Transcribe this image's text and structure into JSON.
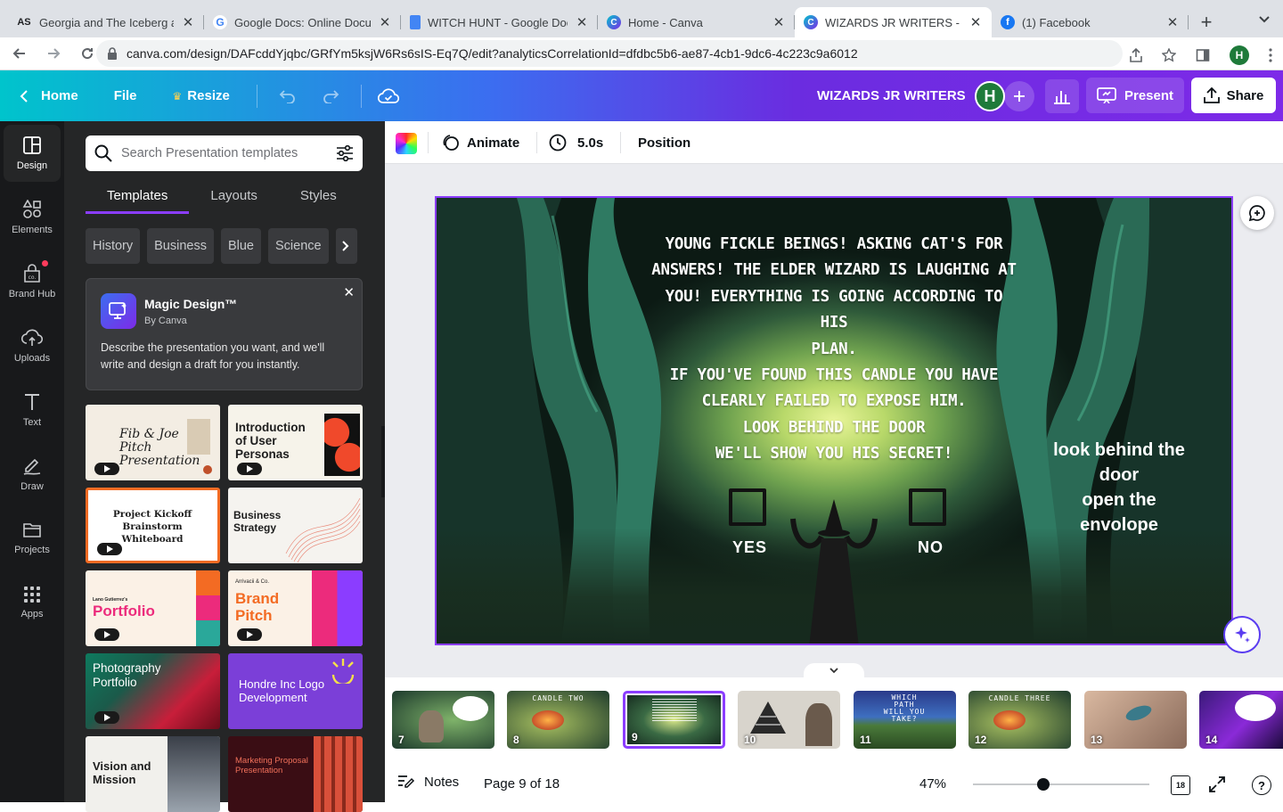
{
  "browser": {
    "tabs": [
      {
        "title": "Georgia and The Iceberg and",
        "favicon": "AS",
        "active": false
      },
      {
        "title": "Google Docs: Online Docum",
        "favicon": "G",
        "active": false
      },
      {
        "title": "WITCH HUNT - Google Doc",
        "favicon": "docs",
        "active": false
      },
      {
        "title": "Home - Canva",
        "favicon": "canva",
        "active": false
      },
      {
        "title": "WIZARDS JR WRITERS - Pr",
        "favicon": "canva",
        "active": true
      },
      {
        "title": "(1) Facebook",
        "favicon": "facebook",
        "active": false
      }
    ],
    "url": "canva.com/design/DAFcddYjqbc/GRfYm5ksjW6Rs6sIS-Eq7Q/edit?analyticsCorrelationId=dfdbc5b6-ae87-4cb1-9dc6-4c223c9a6012",
    "profile_initial": "H"
  },
  "header": {
    "home": "Home",
    "file": "File",
    "resize": "Resize",
    "title": "WIZARDS JR WRITERS",
    "user_initial": "H",
    "present": "Present",
    "share": "Share"
  },
  "rail": [
    {
      "label": "Design",
      "icon": "layout-icon"
    },
    {
      "label": "Elements",
      "icon": "shapes-icon"
    },
    {
      "label": "Brand Hub",
      "icon": "brand-icon"
    },
    {
      "label": "Uploads",
      "icon": "cloud-upload-icon"
    },
    {
      "label": "Text",
      "icon": "text-icon"
    },
    {
      "label": "Draw",
      "icon": "pen-icon"
    },
    {
      "label": "Projects",
      "icon": "folder-icon"
    },
    {
      "label": "Apps",
      "icon": "grid-icon"
    }
  ],
  "panel": {
    "search_placeholder": "Search Presentation templates",
    "tabs": [
      "Templates",
      "Layouts",
      "Styles"
    ],
    "chips": [
      "History",
      "Business",
      "Blue",
      "Science"
    ],
    "magic": {
      "title": "Magic Design™",
      "byline": "By Canva",
      "description": "Describe the presentation you want, and we'll write and design a draft for you instantly."
    },
    "templates": [
      {
        "title": "Fib & Joe Pitch Presentation"
      },
      {
        "title": "Introduction of User Personas"
      },
      {
        "title": "Project Kickoff Brainstorm Whiteboard"
      },
      {
        "title": "Business Strategy"
      },
      {
        "title": "Portfolio",
        "sub": "Lano Gutierrez's"
      },
      {
        "title": "Brand Pitch",
        "sub": "Arrivacii & Co."
      },
      {
        "title": "Photography Portfolio"
      },
      {
        "title": "Hondre Inc Logo Development"
      },
      {
        "title": "Vision and Mission"
      },
      {
        "title": "Marketing Proposal Presentation"
      }
    ]
  },
  "toolbar": {
    "animate": "Animate",
    "duration": "5.0s",
    "position": "Position"
  },
  "slide": {
    "main_text": [
      "Young fickle beings! Asking cat's for",
      "answers! The elder wizard is laughing at",
      "you! Everything is going according to his",
      "plan.",
      "If you've found this candle you have",
      "clearly failed to expose him.",
      "look behind the door",
      "we'll show you his secret!"
    ],
    "side_note": [
      "look behind the",
      "door",
      "open the",
      "envolope"
    ],
    "yes": "YES",
    "no": "NO"
  },
  "filmstrip": [
    {
      "num": "7",
      "caption": ""
    },
    {
      "num": "8",
      "caption": "CANDLE TWO"
    },
    {
      "num": "9",
      "caption": ""
    },
    {
      "num": "10",
      "caption": ""
    },
    {
      "num": "11",
      "caption": "WHICH PATH WILL YOU TAKE?"
    },
    {
      "num": "12",
      "caption": "CANDLE THREE"
    },
    {
      "num": "13",
      "caption": ""
    },
    {
      "num": "14",
      "caption": ""
    }
  ],
  "footer": {
    "notes": "Notes",
    "page": "Page 9 of 18",
    "zoom": "47%",
    "zoom_value": 0.4,
    "page_count": "18"
  },
  "colors": {
    "accent": "#8b3dff",
    "rail_bg": "#18191b",
    "panel_bg": "#252627"
  }
}
